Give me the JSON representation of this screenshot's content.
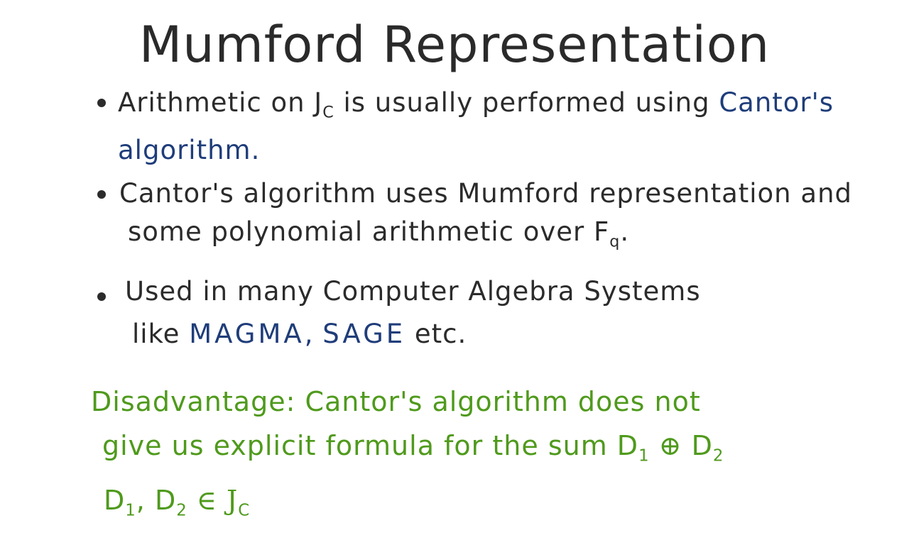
{
  "title": "Mumford Representation",
  "colors": {
    "ink": "#2b2b2b",
    "blue": "#1f3d7a",
    "green": "#4f9a1c"
  },
  "bullets": [
    {
      "line1_text": "Arithmetic on J",
      "line1_sub": "C",
      "line1_rest": " is usually performed using ",
      "line1_link": "Cantor's",
      "line2_link": "algorithm."
    },
    {
      "line1": "Cantor's algorithm uses Mumford representation and",
      "line2_text": "some polynomial arithmetic over F",
      "line2_sub": "q",
      "line2_end": "."
    },
    {
      "line1": "Used in many Computer Algebra Systems",
      "line2_prefix": "like ",
      "system1": "MAGMA",
      "separator": ", ",
      "system2": "SAGE",
      "line2_suffix": " etc."
    }
  ],
  "disadvantage": {
    "line1": "Disadvantage: Cantor's algorithm does not",
    "line2_text": "give us explicit formula for the sum D",
    "line2_sub1": "1",
    "line2_op": " ⊕ ",
    "line2_d2": "D",
    "line2_sub2": "2",
    "line3_d1": "D",
    "line3_sub1": "1",
    "line3_sep": ", D",
    "line3_sub2": "2",
    "line3_in": " ∈ J",
    "line3_subc": "C"
  }
}
